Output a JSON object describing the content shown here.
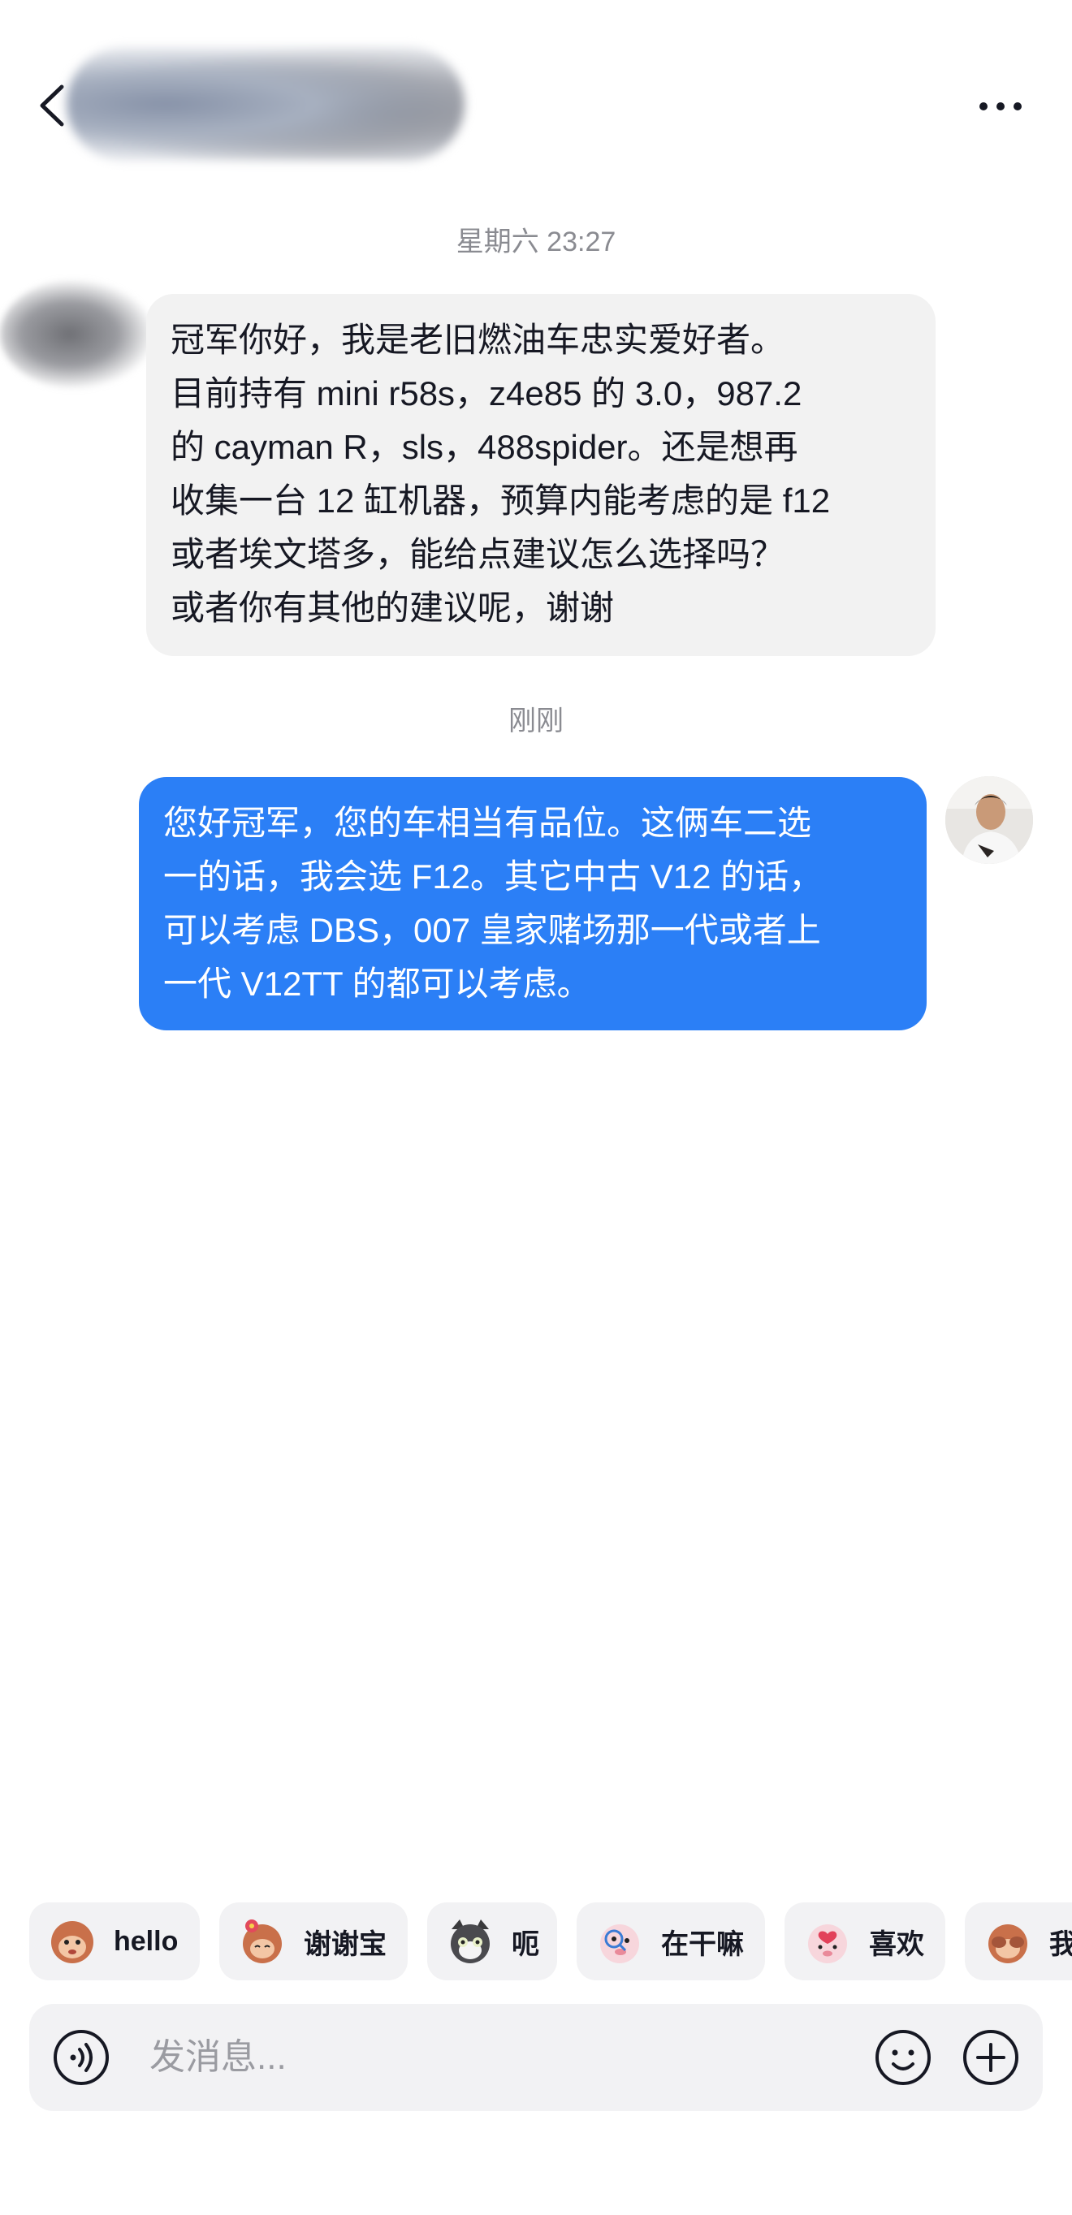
{
  "header": {
    "back_icon": "chevron-left-icon",
    "more_icon": "more-horizontal-icon"
  },
  "messages": [
    {
      "timestamp": "星期六 23:27",
      "sender": "other",
      "lines": [
        "冠军你好，我是老旧燃油车忠实爱好者。",
        "目前持有 mini r58s，z4e85 的 3.0，987.2",
        "的 cayman R，sls，488spider。还是想再",
        "收集一台 12 缸机器，预算内能考虑的是 f12",
        "或者埃文塔多，能给点建议怎么选择吗？",
        "或者你有其他的建议呢，谢谢"
      ]
    },
    {
      "timestamp": "刚刚",
      "sender": "me",
      "lines": [
        "您好冠军，您的车相当有品位。这俩车二选",
        "一的话，我会选 F12。其它中古 V12 的话，",
        "可以考虑 DBS，007 皇家赌场那一代或者上",
        "一代 V12TT 的都可以考虑。"
      ]
    }
  ],
  "quick_replies": [
    {
      "label": "hello",
      "icon": "monkey-emoji-icon"
    },
    {
      "label": "谢谢宝",
      "icon": "monkey-flower-emoji-icon"
    },
    {
      "label": "呃",
      "icon": "cat-emoji-icon"
    },
    {
      "label": "在干嘛",
      "icon": "pig-magnifier-emoji-icon"
    },
    {
      "label": "喜欢",
      "icon": "pig-heart-emoji-icon"
    },
    {
      "label": "我",
      "icon": "monkey-cover-emoji-icon"
    }
  ],
  "input_bar": {
    "placeholder": "发消息...",
    "value": "",
    "voice_icon": "voice-icon",
    "emoji_icon": "smiley-icon",
    "plus_icon": "plus-circle-icon"
  },
  "colors": {
    "outgoing_bubble": "#2b7ff6",
    "incoming_bubble": "#f2f2f2",
    "timestamp_text": "#8a8b91"
  }
}
